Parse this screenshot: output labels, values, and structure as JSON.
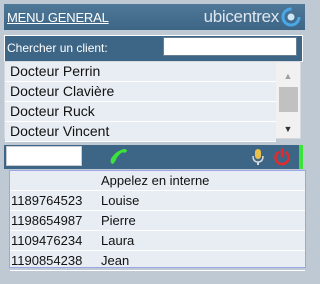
{
  "header": {
    "menu_label": "MENU GENERAL",
    "logo_text": "ubicentrex"
  },
  "search": {
    "label": "Chercher un client:",
    "value": ""
  },
  "clients": [
    "Docteur Perrin",
    "Docteur Clavière",
    "Docteur Ruck",
    "Docteur Vincent"
  ],
  "dialer": {
    "value": ""
  },
  "dropdown": {
    "header": "Appelez en interne",
    "rows": [
      {
        "number": "1189764523",
        "name": "Louise"
      },
      {
        "number": "1198654987",
        "name": "Pierre"
      },
      {
        "number": "1109476234",
        "name": "Laura"
      },
      {
        "number": "1190854238",
        "name": "Jean"
      }
    ]
  },
  "icons": {
    "logo": "ubicentrex-swirl-icon",
    "call": "phone-handset-icon",
    "scroll_up": "scroll-up-arrow-icon",
    "scroll_down": "scroll-down-arrow-icon",
    "mic": "microphone-icon",
    "power": "power-icon"
  },
  "colors": {
    "header_bg": "#3d6686",
    "list_row_bg": "#e7edf3",
    "call_green": "#3be33b",
    "power_red": "#e32b2b",
    "mic_yellow": "#e8c04a",
    "logo_blue": "#4aa8e8"
  }
}
